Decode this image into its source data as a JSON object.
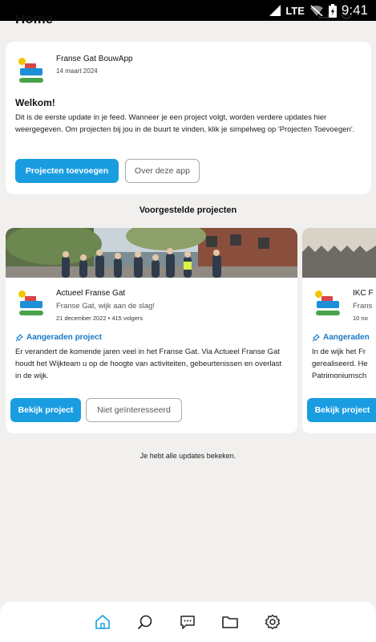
{
  "status_bar": {
    "network": "LTE",
    "time": "9:41"
  },
  "header": {
    "title": "Home"
  },
  "intro": {
    "org": "Franse Gat BouwApp",
    "date": "14 maart 2024",
    "heading": "Welkom!",
    "body": "Dit is de eerste update in je feed. Wanneer je een project volgt, worden verdere updates hier weergegeven. Om projecten bij jou in de buurt te vinden, klik je simpelweg op 'Projecten Toevoegen'.",
    "primary_button": "Projecten toevoegen",
    "secondary_button": "Over deze app"
  },
  "suggested": {
    "title": "Voorgestelde projecten",
    "projects": [
      {
        "name": "Actueel Franse Gat",
        "tagline": "Franse Gat, wijk aan de slag!",
        "meta": "21 december 2022 • 415 volgers",
        "recommended": "Aangeraden project",
        "description": "Er verandert de komende jaren veel in het Franse Gat. Via Actueel Franse Gat houdt het Wijkteam u op de hoogte van activiteiten, gebeurtenissen en overlast in de wijk.",
        "view_button": "Bekijk project",
        "dismiss_button": "Niet geïnteresseerd"
      },
      {
        "name": "IKC F",
        "tagline": "Frans",
        "meta": "10 no",
        "recommended": "Aangeraden",
        "description": "In de wijk het Fr gerealiseerd. He Patrimoniumsch",
        "view_button": "Bekijk project"
      }
    ]
  },
  "footer_message": "Je hebt alle updates bekeken.",
  "bottom_nav": [
    {
      "icon": "home-icon",
      "active": true
    },
    {
      "icon": "search-icon",
      "active": false
    },
    {
      "icon": "chat-icon",
      "active": false
    },
    {
      "icon": "folder-icon",
      "active": false
    },
    {
      "icon": "settings-icon",
      "active": false
    }
  ],
  "colors": {
    "accent": "#1a9de0",
    "link": "#1a78c2",
    "background": "#f1f0ee"
  }
}
